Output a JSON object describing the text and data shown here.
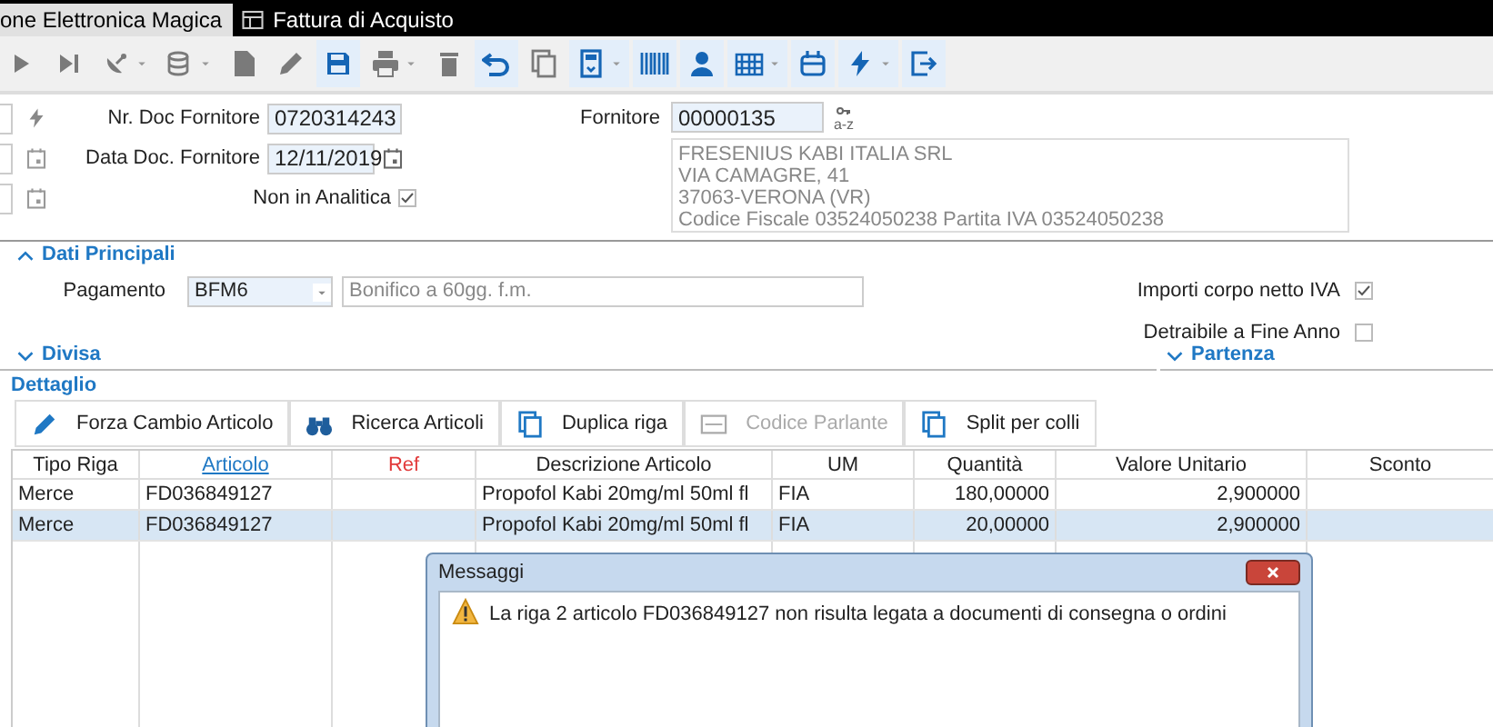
{
  "tabs": [
    {
      "label": "one Elettronica Magica",
      "selected": true
    },
    {
      "label": "Fattura di Acquisto",
      "selected": false
    }
  ],
  "toolbar": [
    {
      "disabled": true,
      "menu": false
    },
    {
      "disabled": true,
      "menu": false
    },
    {
      "disabled": true,
      "menu": true
    },
    {
      "disabled": true,
      "menu": true
    },
    {
      "disabled": true,
      "menu": false
    },
    {
      "disabled": true,
      "menu": false
    },
    {
      "disabled": false,
      "menu": false
    },
    {
      "disabled": true,
      "menu": true
    },
    {
      "disabled": true,
      "menu": false
    },
    {
      "disabled": false,
      "menu": false
    },
    {
      "disabled": true,
      "menu": false
    },
    {
      "disabled": false,
      "menu": true
    },
    {
      "disabled": false,
      "menu": false
    },
    {
      "disabled": false,
      "menu": false
    },
    {
      "disabled": false,
      "menu": true
    },
    {
      "disabled": false,
      "menu": false
    },
    {
      "disabled": false,
      "menu": true
    },
    {
      "disabled": false,
      "menu": false
    }
  ],
  "header": {
    "nr_doc_label": "Nr. Doc Fornitore",
    "nr_doc": "0720314243",
    "data_doc_label": "Data Doc. Fornitore",
    "data_doc": "12/11/2019",
    "non_analitica_label": "Non in Analitica",
    "non_analitica_checked": true,
    "fornitore_label": "Fornitore",
    "fornitore": "00000135",
    "key_caption": "a-z",
    "address": [
      "FRESENIUS KABI ITALIA SRL",
      "VIA CAMAGRE, 41",
      "37063-VERONA (VR)",
      "Codice Fiscale 03524050238 Partita IVA 03524050238"
    ]
  },
  "dati_principali": {
    "title": "Dati Principali",
    "expanded": true,
    "pagamento_label": "Pagamento",
    "pagamento": "BFM6",
    "pagamento_desc": "Bonifico a 60gg. f.m.",
    "options": [
      {
        "label": "Importi corpo netto IVA",
        "checked": true
      },
      {
        "label": "Detraibile a Fine Anno",
        "checked": false
      }
    ]
  },
  "sections": [
    {
      "title": "Divisa",
      "expanded": false
    },
    {
      "title": "Partenza",
      "expanded": false
    }
  ],
  "dettaglio": {
    "title": "Dettaglio",
    "buttons": [
      {
        "label": "Forza Cambio Articolo",
        "disabled": false
      },
      {
        "label": "Ricerca Articoli",
        "disabled": false
      },
      {
        "label": "Duplica riga",
        "disabled": false
      },
      {
        "label": "Codice Parlante",
        "disabled": true
      },
      {
        "label": "Split per colli",
        "disabled": false
      }
    ],
    "columns": [
      {
        "label": "Tipo Riga",
        "kind": "plain"
      },
      {
        "label": "Articolo",
        "kind": "link"
      },
      {
        "label": "Ref",
        "kind": "alert"
      },
      {
        "label": "Descrizione Articolo",
        "kind": "plain"
      },
      {
        "label": "UM",
        "kind": "plain"
      },
      {
        "label": "Quantità",
        "kind": "plain"
      },
      {
        "label": "Valore Unitario",
        "kind": "plain"
      },
      {
        "label": "Sconto",
        "kind": "plain"
      }
    ],
    "rows": [
      {
        "selected": false,
        "cells": [
          "Merce",
          "FD036849127",
          "",
          "Propofol Kabi 20mg/ml 50ml fl",
          "FIA",
          "180,00000",
          "2,900000",
          ""
        ]
      },
      {
        "selected": true,
        "cells": [
          "Merce",
          "FD036849127",
          "",
          "Propofol Kabi 20mg/ml 50ml fl",
          "FIA",
          "20,00000",
          "2,900000",
          ""
        ]
      }
    ]
  },
  "dialog": {
    "title": "Messaggi",
    "message": "La riga 2 articolo FD036849127 non risulta legata a documenti di consegna o ordini"
  }
}
